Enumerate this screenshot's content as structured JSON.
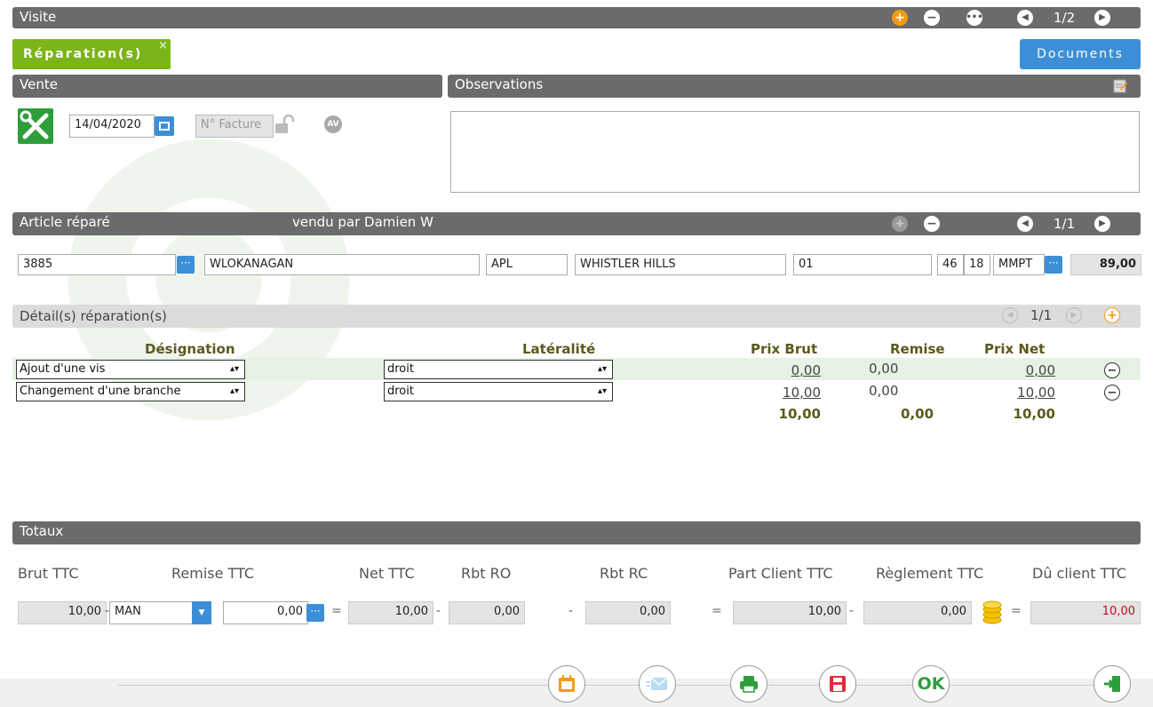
{
  "header": {
    "title": "Visite",
    "pager": "1/2"
  },
  "tab": {
    "label": "Réparation(s)",
    "close": "×"
  },
  "documents_label": "Documents",
  "vente": {
    "title": "Vente",
    "date": "14/04/2020",
    "invoice_placeholder": "N° Facture",
    "av_badge": "AV"
  },
  "observations": {
    "title": "Observations",
    "text": ""
  },
  "article": {
    "title": "Article réparé",
    "seller": "vendu par Damien W",
    "pager": "1/1",
    "fields": {
      "code": "3885",
      "brand": "WLOKANAGAN",
      "ref": "APL",
      "model": "WHISTLER HILLS",
      "color": "01",
      "size1": "46",
      "size2": "18",
      "type": "MMPT",
      "price": "89,00"
    }
  },
  "details": {
    "title": "Détail(s) réparation(s)",
    "pager": "1/1",
    "headers": {
      "designation": "Désignation",
      "lateralite": "Latéralité",
      "prix_brut": "Prix Brut",
      "remise": "Remise",
      "prix_net": "Prix Net"
    },
    "rows": [
      {
        "designation": "Ajout d'une vis",
        "lateralite": "droit",
        "prix_brut": "0,00",
        "remise": "0,00",
        "prix_net": "0,00"
      },
      {
        "designation": "Changement d'une branche",
        "lateralite": "droit",
        "prix_brut": "10,00",
        "remise": "0,00",
        "prix_net": "10,00"
      }
    ],
    "totals": {
      "prix_brut": "10,00",
      "remise": "0,00",
      "prix_net": "10,00"
    }
  },
  "totaux": {
    "title": "Totaux",
    "labels": {
      "brut": "Brut TTC",
      "remise": "Remise TTC",
      "net": "Net TTC",
      "rbt_ro": "Rbt RO",
      "rbt_rc": "Rbt RC",
      "part_client": "Part Client TTC",
      "reglement": "Règlement TTC",
      "du_client": "Dû client TTC"
    },
    "values": {
      "brut": "10,00",
      "remise_mode": "MAN",
      "remise": "0,00",
      "net": "10,00",
      "rbt_ro": "0,00",
      "rbt_rc": "0,00",
      "part_client": "10,00",
      "reglement": "0,00",
      "du_client": "10,00"
    },
    "ops": {
      "minus": "-",
      "equals": "="
    }
  },
  "footer": {
    "ok_label": "OK"
  },
  "colors": {
    "bar": "#6b6b6b",
    "green": "#7cb518",
    "blue": "#3c8fd6",
    "orange": "#f39c12",
    "olive": "#5a5a1e",
    "red": "#d0021b"
  }
}
